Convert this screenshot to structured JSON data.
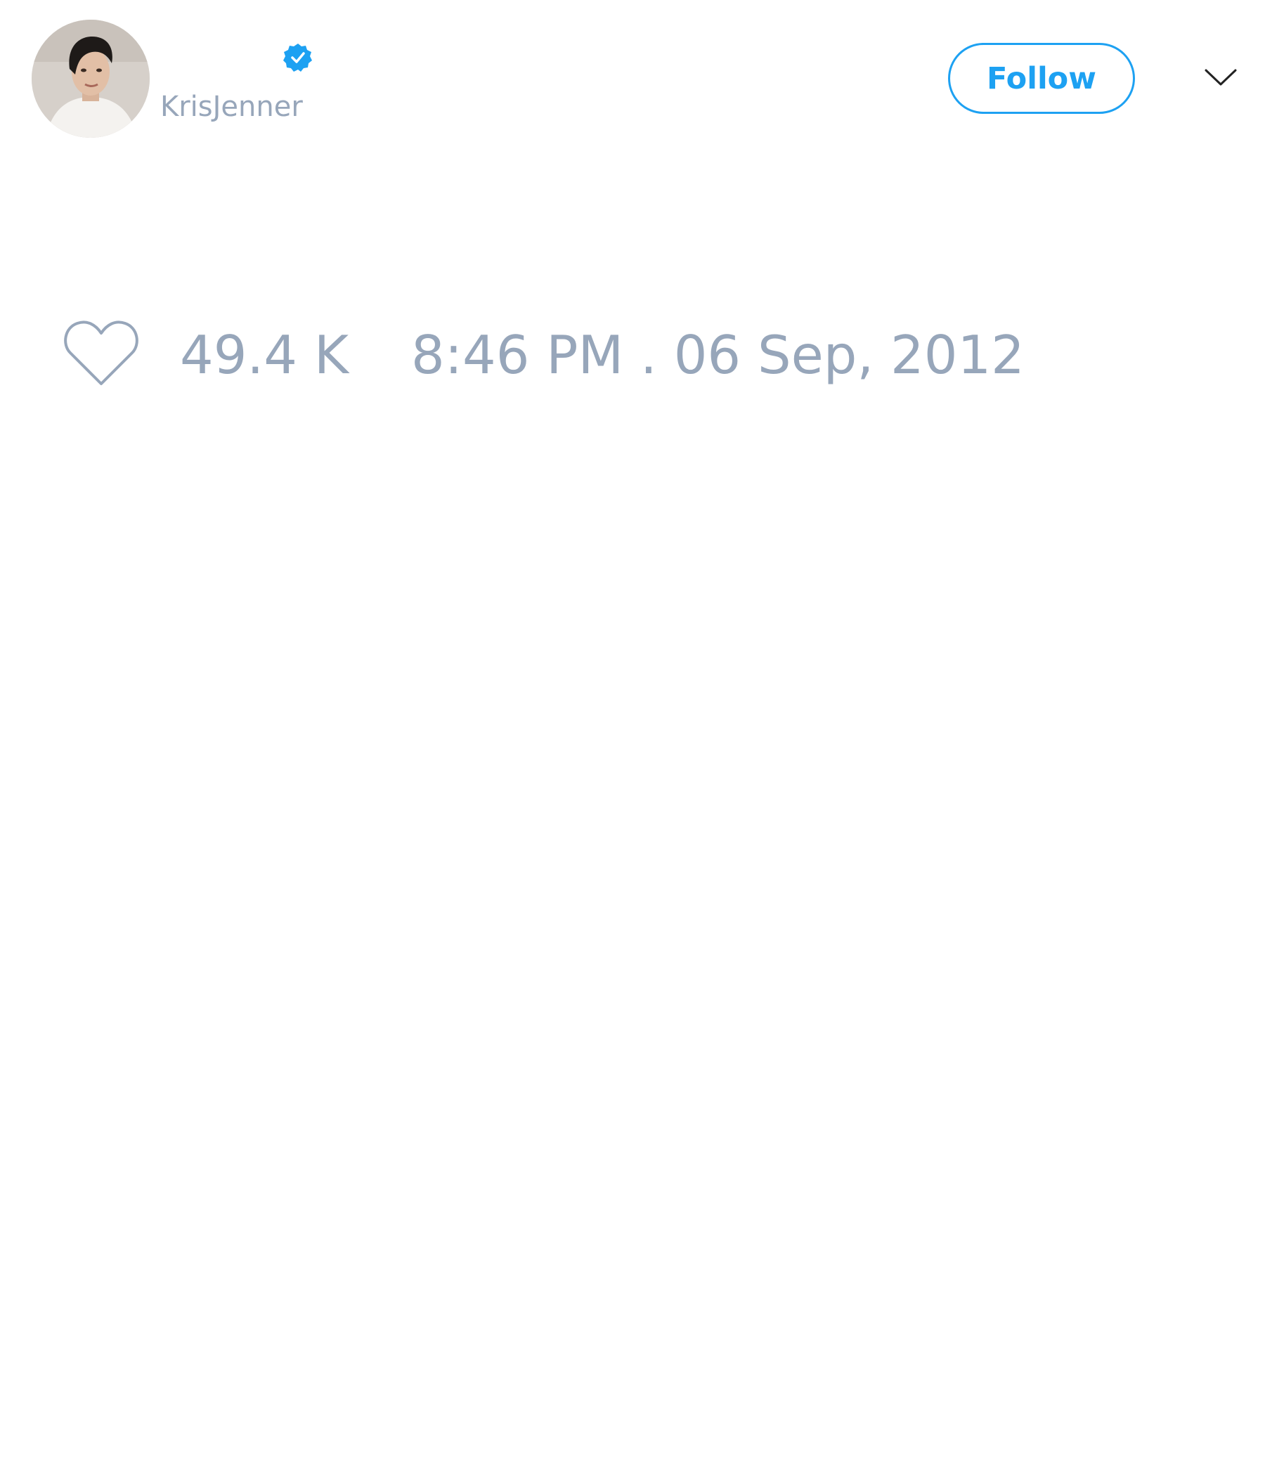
{
  "author": {
    "handle": "KrisJenner",
    "verified": true,
    "avatar_icon": "profile-photo"
  },
  "actions": {
    "follow_label": "Follow",
    "menu_icon": "chevron-down-icon"
  },
  "stats": {
    "like_icon": "heart-icon",
    "like_count": "49.4 K",
    "timestamp": "8:46 PM . 06 Sep, 2012"
  },
  "colors": {
    "accent": "#1da1f2",
    "muted_text": "#97a6ba",
    "background": "#ffffff"
  }
}
